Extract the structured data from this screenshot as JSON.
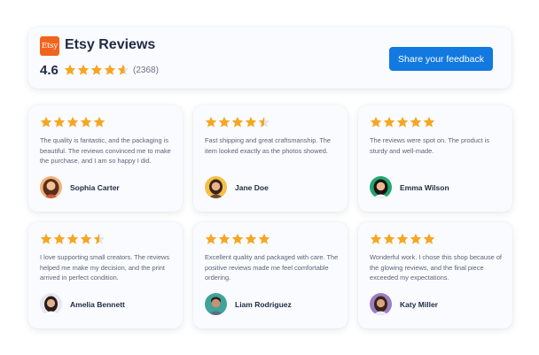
{
  "header": {
    "logo_text": "Etsy",
    "title": "Etsy Reviews",
    "rating": "4.6",
    "rating_stars": 4.6,
    "count": "(2368)",
    "share_button": "Share your feedback"
  },
  "colors": {
    "accent": "#1279e0",
    "star": "#f6a623",
    "etsy_orange": "#f1641e"
  },
  "reviews": [
    {
      "stars": 5,
      "text": "The quality is fantastic, and the packaging is beautiful. The reviews convinced me to make the purchase, and I am so happy I did.",
      "name": "Sophia Carter"
    },
    {
      "stars": 4.5,
      "text": "Fast shipping and great craftsmanship. The item looked exactly as the photos showed.",
      "name": "Jane Doe"
    },
    {
      "stars": 5,
      "text": "The reviews were spot on. The product is sturdy and well-made.",
      "name": "Emma Wilson"
    },
    {
      "stars": 4.5,
      "text": "I love supporting small creators. The reviews helped me make my decision, and the print arrived in perfect condition.",
      "name": "Amelia Bennett"
    },
    {
      "stars": 5,
      "text": "Excellent quality and packaged with care. The positive reviews made me feel comfortable ordering.",
      "name": "Liam Rodriguez"
    },
    {
      "stars": 5,
      "text": "Wonderful work. I chose this shop because of the glowing reviews, and the final piece exceeded my expectations.",
      "name": "Katy Miller"
    }
  ]
}
